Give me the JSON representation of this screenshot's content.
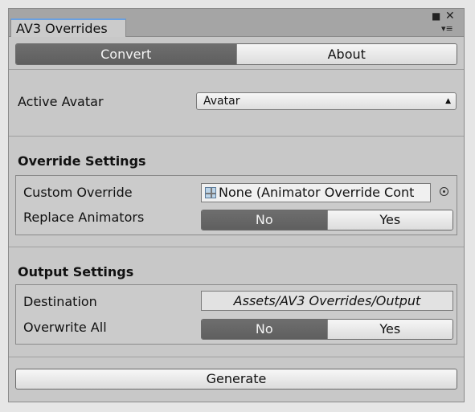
{
  "window": {
    "tab_title": "AV3 Overrides",
    "maximize_icon": "square-icon",
    "close_icon": "close-icon",
    "menu_icon": "context-menu-icon"
  },
  "toolbar": {
    "tabs": [
      {
        "label": "Convert",
        "selected": true
      },
      {
        "label": "About",
        "selected": false
      }
    ]
  },
  "avatar": {
    "label": "Active Avatar",
    "selected": "Avatar"
  },
  "override_settings": {
    "header": "Override Settings",
    "custom_override_label": "Custom Override",
    "custom_override_value": "None (Animator Override Cont",
    "replace_label": "Replace Animators",
    "replace_no": "No",
    "replace_yes": "Yes",
    "replace_selected": "No"
  },
  "output_settings": {
    "header": "Output Settings",
    "destination_label": "Destination",
    "destination_value": "Assets/AV3 Overrides/Output",
    "overwrite_label": "Overwrite All",
    "overwrite_no": "No",
    "overwrite_yes": "Yes",
    "overwrite_selected": "No"
  },
  "actions": {
    "generate_label": "Generate"
  },
  "colors": {
    "accent_tab_border": "#6aa0e0",
    "selected_segment": "#666666"
  }
}
